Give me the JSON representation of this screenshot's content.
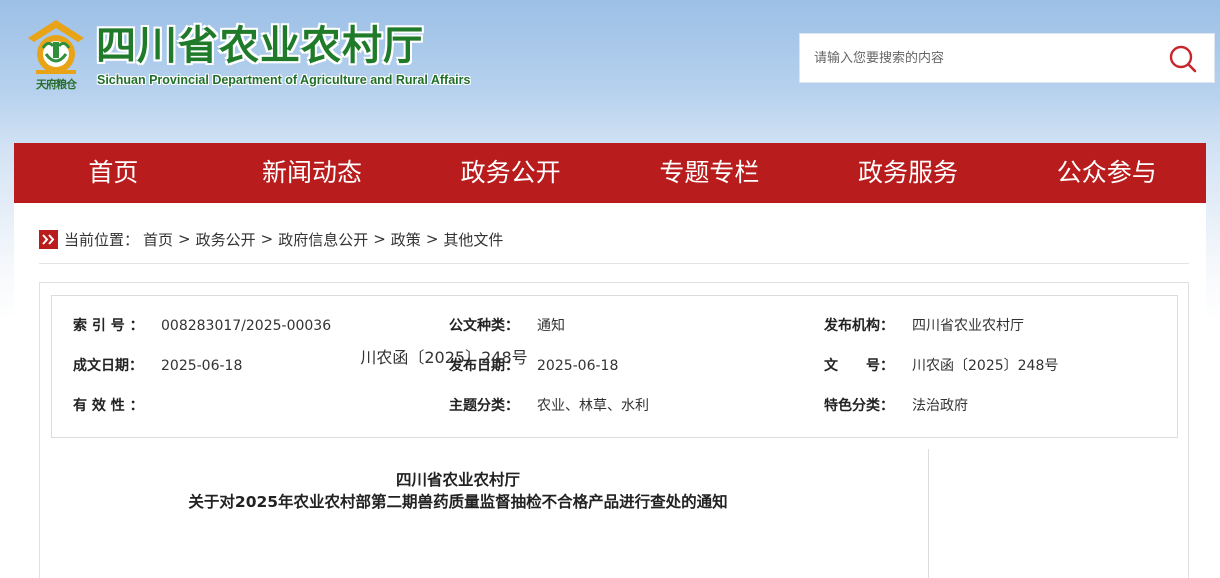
{
  "header": {
    "title_cn": "四川省农业农村厅",
    "title_en": "Sichuan Provincial Department of Agriculture and Rural Affairs",
    "emblem_text": "天府粮仓",
    "search": {
      "placeholder": "请输入您要搜索的内容",
      "icon": "search-icon"
    }
  },
  "nav": {
    "items": [
      {
        "label": "首页"
      },
      {
        "label": "新闻动态"
      },
      {
        "label": "政务公开"
      },
      {
        "label": "专题专栏"
      },
      {
        "label": "政务服务"
      },
      {
        "label": "公众参与"
      }
    ]
  },
  "breadcrumb": {
    "prefix": "当前位置：",
    "separator": ">",
    "items": [
      "首页",
      "政务公开",
      "政府信息公开",
      "政策",
      "其他文件"
    ]
  },
  "meta": {
    "index_no": {
      "label": "索 引 号 ：",
      "value": "008283017/2025-00036"
    },
    "doc_type": {
      "label": "公文种类：",
      "value": "通知"
    },
    "publisher": {
      "label": "发布机构：",
      "value": "四川省农业农村厅"
    },
    "created_date": {
      "label": "成文日期：",
      "value": "2025-06-18"
    },
    "publish_date": {
      "label": "发布日期：",
      "value": "2025-06-18"
    },
    "doc_no": {
      "label": "文　　号：",
      "value": "川农函〔2025〕248号"
    },
    "validity": {
      "label": "有 效 性 ：",
      "value": ""
    },
    "topic": {
      "label": "主题分类：",
      "value": "农业、林草、水利"
    },
    "feature": {
      "label": "特色分类：",
      "value": "法治政府"
    }
  },
  "article": {
    "title_line1": "四川省农业农村厅",
    "title_line2": "关于对2025年农业农村部第二期兽药质量监督抽检不合格产品进行查处的通知",
    "doc_no": "川农函〔2025〕248号"
  },
  "colors": {
    "brand_red": "#b91c1c",
    "brand_green": "#1f7a2a",
    "emblem_gold": "#e8a317"
  }
}
